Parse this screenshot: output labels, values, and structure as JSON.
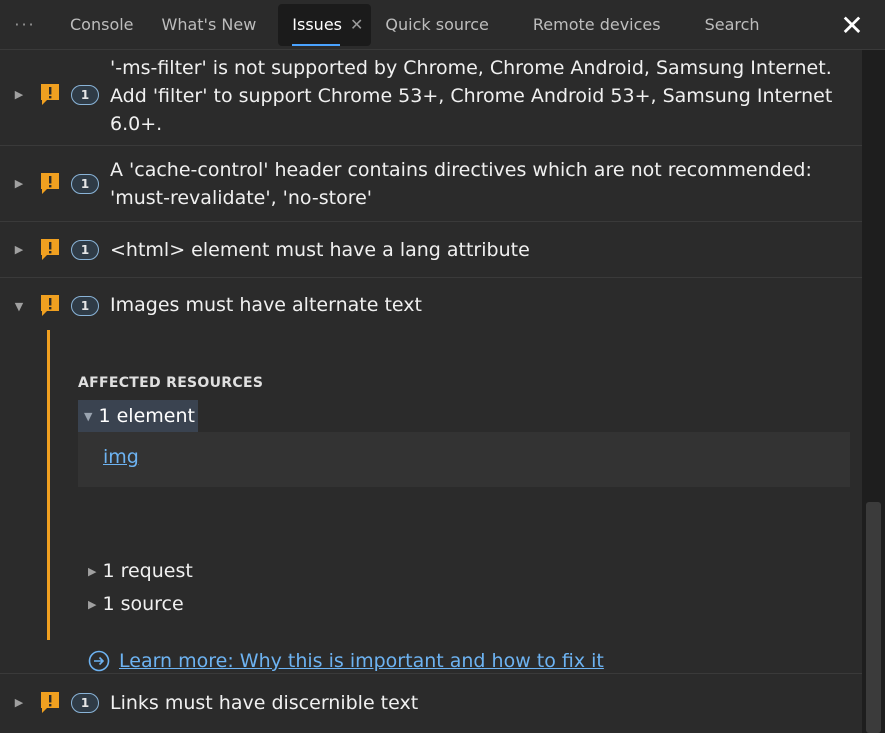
{
  "tabs": {
    "more": "···",
    "items": [
      {
        "label": "Console"
      },
      {
        "label": "What's New"
      },
      {
        "label": "Issues"
      },
      {
        "label": "Quick source"
      },
      {
        "label": "Remote devices"
      },
      {
        "label": "Search"
      }
    ],
    "active_close": "✕",
    "panel_close": "✕"
  },
  "issues": [
    {
      "count": "1",
      "text": "'-ms-filter' is not supported by Chrome, Chrome Android, Samsung Internet. Add 'filter' to support Chrome 53+, Chrome Android 53+, Samsung Internet 6.0+."
    },
    {
      "count": "1",
      "text": "A 'cache-control' header contains directives which are not recommended: 'must-revalidate', 'no-store'"
    },
    {
      "count": "1",
      "text": "<html> element must have a lang attribute"
    },
    {
      "count": "1",
      "text": "Images must have alternate text"
    },
    {
      "count": "1",
      "text": "Links must have discernible text"
    }
  ],
  "expanded": {
    "affected_title": "AFFECTED RESOURCES",
    "element_toggle": "1 element",
    "element_link": "img",
    "request_toggle": "1 request",
    "source_toggle": "1 source",
    "learn_more": "Learn more: Why this is important and how to fix it"
  },
  "icons": {
    "warning": "warning-icon",
    "chevron_right": "chevron-right-icon",
    "chevron_down": "chevron-down-icon",
    "external_link": "arrow-circle-icon"
  },
  "colors": {
    "accent": "#4aa3ff",
    "warning": "#f0a020",
    "link": "#6db3f2"
  }
}
